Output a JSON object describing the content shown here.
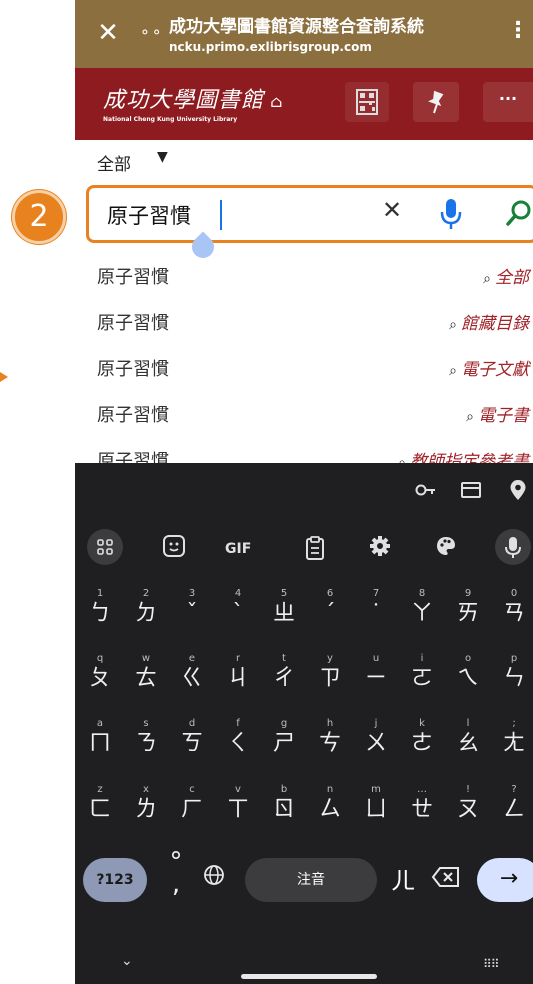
{
  "tab_bar": {
    "close": "✕",
    "connection_icon": "⚬⚬",
    "title": "成功大學圖書館資源整合查詢系統",
    "url": "ncku.primo.exlibrisgroup.com",
    "menu": "⋮"
  },
  "library_header": {
    "logo_cn": "成功大學圖書館",
    "logo_en": "National Cheng Kung University Library",
    "more": "···"
  },
  "scope": {
    "label": "全部",
    "caret": "▼"
  },
  "search": {
    "value": "原子習慣",
    "clear": "✕"
  },
  "step_badge": "2",
  "suggestions": [
    {
      "text": "原子習慣",
      "scope": "全部"
    },
    {
      "text": "原子習慣",
      "scope": "館藏目錄"
    },
    {
      "text": "原子習慣",
      "scope": "電子文獻"
    },
    {
      "text": "原子習慣",
      "scope": "電子書"
    },
    {
      "text": "原子習慣",
      "scope": "教師指定參考書"
    }
  ],
  "keyboard": {
    "tools": [
      "GIF"
    ],
    "row1": [
      {
        "hint": "1",
        "key": "ㄅ"
      },
      {
        "hint": "2",
        "key": "ㄉ"
      },
      {
        "hint": "3",
        "key": "ˇ"
      },
      {
        "hint": "4",
        "key": "ˋ"
      },
      {
        "hint": "5",
        "key": "ㄓ"
      },
      {
        "hint": "6",
        "key": "ˊ"
      },
      {
        "hint": "7",
        "key": "˙"
      },
      {
        "hint": "8",
        "key": "ㄚ"
      },
      {
        "hint": "9",
        "key": "ㄞ"
      },
      {
        "hint": "0",
        "key": "ㄢ"
      }
    ],
    "row2": [
      {
        "hint": "q",
        "key": "ㄆ"
      },
      {
        "hint": "w",
        "key": "ㄊ"
      },
      {
        "hint": "e",
        "key": "ㄍ"
      },
      {
        "hint": "r",
        "key": "ㄐ"
      },
      {
        "hint": "t",
        "key": "ㄔ"
      },
      {
        "hint": "y",
        "key": "ㄗ"
      },
      {
        "hint": "u",
        "key": "ㄧ"
      },
      {
        "hint": "i",
        "key": "ㄛ"
      },
      {
        "hint": "o",
        "key": "ㄟ"
      },
      {
        "hint": "p",
        "key": "ㄣ"
      }
    ],
    "row3": [
      {
        "hint": "a",
        "key": "ㄇ"
      },
      {
        "hint": "s",
        "key": "ㄋ"
      },
      {
        "hint": "d",
        "key": "ㄎ"
      },
      {
        "hint": "f",
        "key": "ㄑ"
      },
      {
        "hint": "g",
        "key": "ㄕ"
      },
      {
        "hint": "h",
        "key": "ㄘ"
      },
      {
        "hint": "j",
        "key": "ㄨ"
      },
      {
        "hint": "k",
        "key": "ㄜ"
      },
      {
        "hint": "l",
        "key": "ㄠ"
      },
      {
        "hint": ";",
        "key": "ㄤ"
      }
    ],
    "row4": [
      {
        "hint": "z",
        "key": "ㄈ"
      },
      {
        "hint": "x",
        "key": "ㄌ"
      },
      {
        "hint": "c",
        "key": "ㄏ"
      },
      {
        "hint": "v",
        "key": "ㄒ"
      },
      {
        "hint": "b",
        "key": "ㄖ"
      },
      {
        "hint": "n",
        "key": "ㄙ"
      },
      {
        "hint": "m",
        "key": "ㄩ"
      },
      {
        "hint": "…",
        "key": "ㄝ"
      },
      {
        "hint": "!",
        "key": "ㄡ"
      },
      {
        "hint": "?",
        "key": "ㄥ"
      }
    ],
    "symbols_key": "?123",
    "punct_key": "°\n,",
    "space_label": "注音",
    "er_key": "ㄦ",
    "enter": "→",
    "nav_down": "⌄",
    "kb_switch": "⠿⠿"
  },
  "colors": {
    "tab_bar": "#8b6f3f",
    "library_header": "#8d1b1f",
    "accent_orange": "#e8821e",
    "link_red": "#a1232a",
    "mic_blue": "#1a73e8",
    "search_green": "#188038"
  }
}
